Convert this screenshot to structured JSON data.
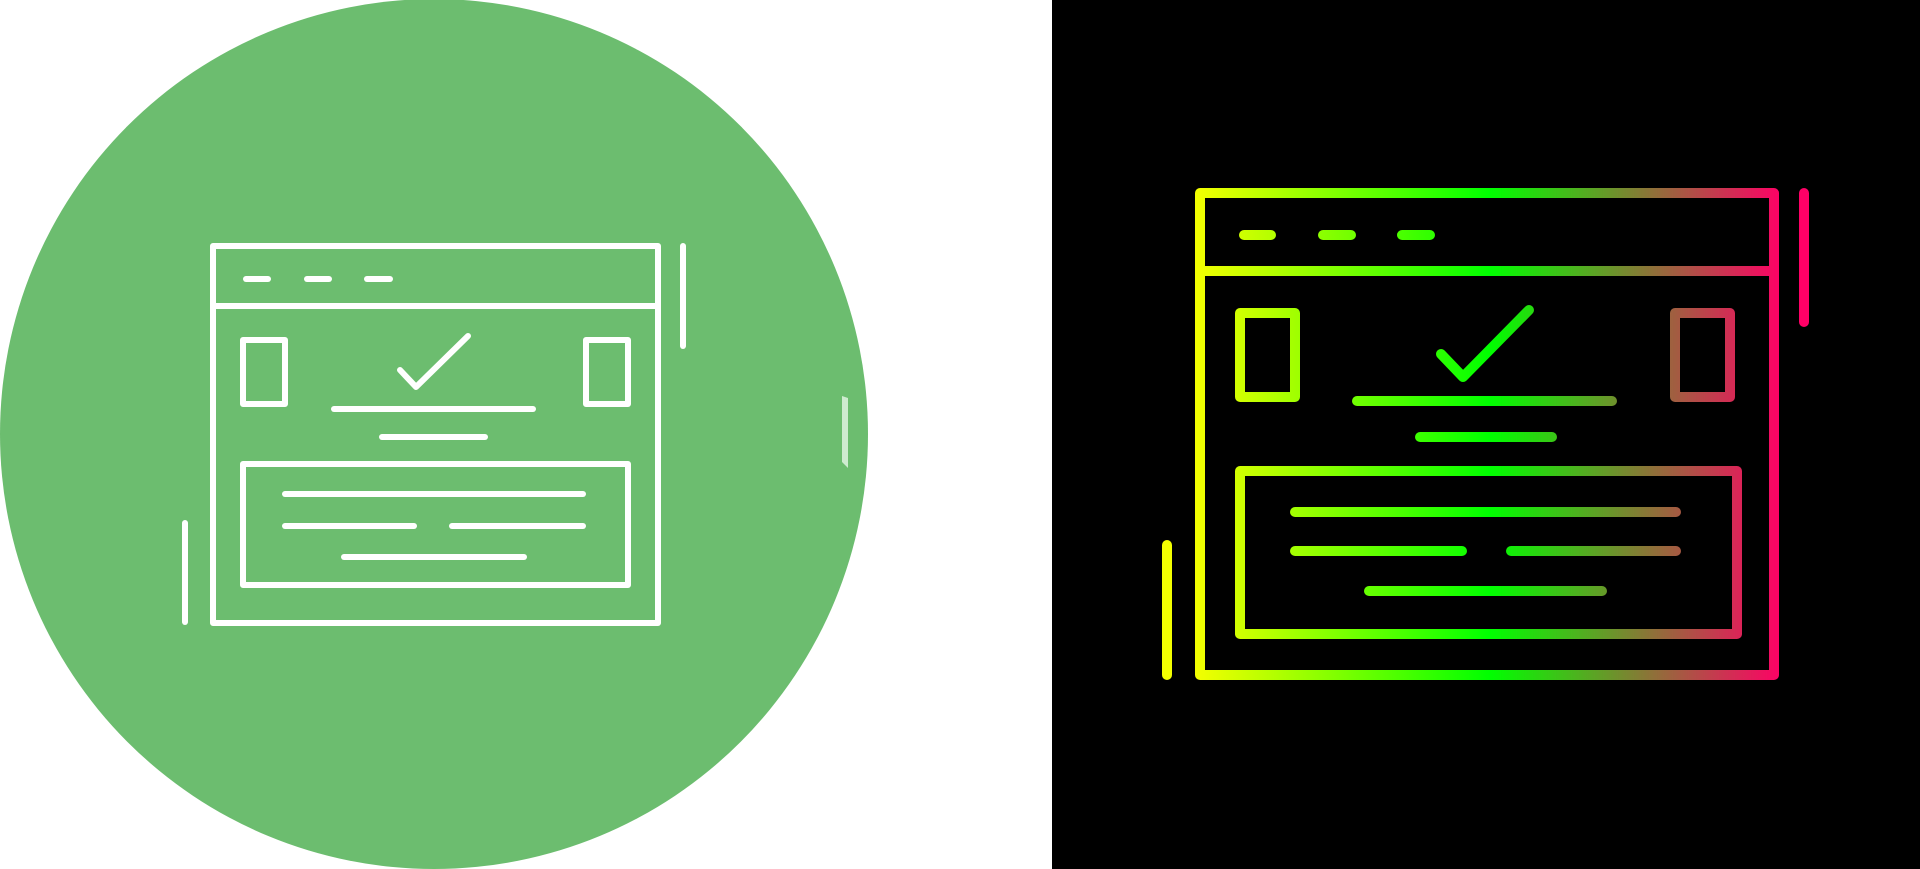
{
  "icons": [
    {
      "name": "web-form-check-icon",
      "variant": "white-line-on-green-circle",
      "colors": {
        "background": "#ffffff",
        "circle": "#6cbd6f",
        "stroke": "#ffffff"
      }
    },
    {
      "name": "web-form-check-icon",
      "variant": "gradient-line-on-black",
      "colors": {
        "background": "#000000",
        "gradient_start": "#f3ff00",
        "gradient_mid": "#00ff00",
        "gradient_end": "#ff0066"
      }
    }
  ]
}
